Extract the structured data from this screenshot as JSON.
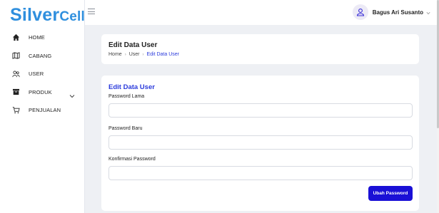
{
  "brand": {
    "part1": "Silver",
    "part2": "Cell"
  },
  "sidebar": {
    "items": [
      {
        "label": "HOME",
        "icon": "home-icon"
      },
      {
        "label": "CABANG",
        "icon": "map-icon"
      },
      {
        "label": "USER",
        "icon": "users-icon"
      },
      {
        "label": "PRODUK",
        "icon": "box-icon",
        "has_submenu": true
      },
      {
        "label": "PENJUALAN",
        "icon": "cart-icon"
      }
    ]
  },
  "topbar": {
    "user_name": "Bagus Ari Susanto"
  },
  "header_card": {
    "title": "Edit Data User",
    "breadcrumb": [
      "Home",
      "User",
      "Edit Data User"
    ]
  },
  "form": {
    "title": "Edit Data User",
    "fields": [
      {
        "label": "Password Lama",
        "value": ""
      },
      {
        "label": "Password Baru",
        "value": ""
      },
      {
        "label": "Konfirmasi Password",
        "value": ""
      }
    ],
    "submit_label": "Ubah Password"
  },
  "colors": {
    "brand_blue": "#2f8fde",
    "accent": "#2b3bdc",
    "button": "#1a10d6",
    "background": "#eef0f4"
  }
}
